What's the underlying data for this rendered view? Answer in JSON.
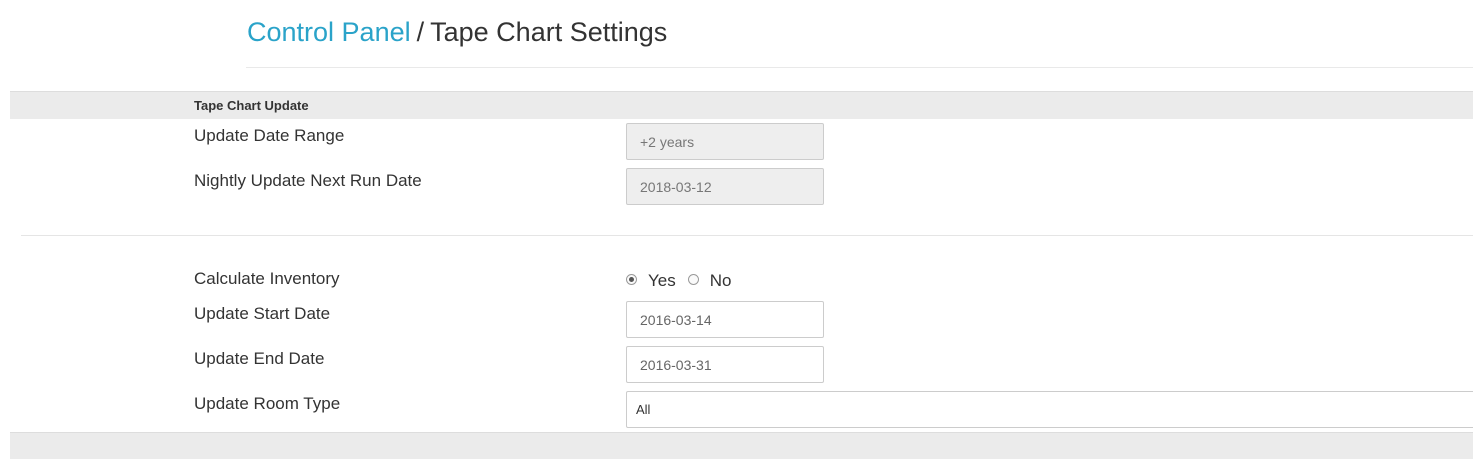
{
  "breadcrumb": {
    "parent": "Control Panel",
    "separator": "/",
    "current": "Tape Chart Settings"
  },
  "section": {
    "title": "Tape Chart Update"
  },
  "fields": {
    "update_date_range": {
      "label": "Update Date Range",
      "value": "+2 years"
    },
    "nightly_next_run": {
      "label": "Nightly Update Next Run Date",
      "value": "2018-03-12"
    },
    "calculate_inventory": {
      "label": "Calculate Inventory",
      "options": [
        "Yes",
        "No"
      ],
      "selected": "Yes"
    },
    "update_start_date": {
      "label": "Update Start Date",
      "value": "2016-03-14"
    },
    "update_end_date": {
      "label": "Update End Date",
      "value": "2016-03-31"
    },
    "update_room_type": {
      "label": "Update Room Type",
      "value": "All"
    }
  },
  "colors": {
    "link": "#2aa3c9",
    "section_bg": "#ebebeb",
    "disabled_input_bg": "#eeeeee"
  }
}
